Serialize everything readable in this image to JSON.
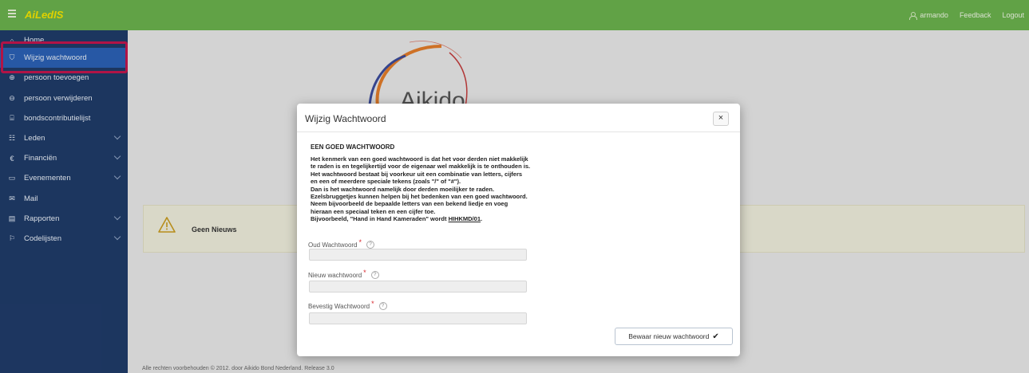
{
  "app": {
    "brand": "AiLedIS"
  },
  "topbar": {
    "username": "armando",
    "feedback": "Feedback",
    "logout": "Logout"
  },
  "sidebar": {
    "items": [
      {
        "label": "Home",
        "icon": "home-icon",
        "glyph": "⌂",
        "dropdown": false,
        "active": false
      },
      {
        "label": "Wijzig wachtwoord",
        "icon": "shield-icon",
        "glyph": "⛉",
        "dropdown": false,
        "active": true
      },
      {
        "label": "persoon toevoegen",
        "icon": "add-circle-icon",
        "glyph": "⊕",
        "dropdown": false,
        "active": false
      },
      {
        "label": "persoon verwijderen",
        "icon": "remove-circle-icon",
        "glyph": "⊖",
        "dropdown": false,
        "active": false
      },
      {
        "label": "bondscontributielijst",
        "icon": "bank-icon",
        "glyph": "⌸",
        "dropdown": false,
        "active": false
      },
      {
        "label": "Leden",
        "icon": "users-icon",
        "glyph": "☷",
        "dropdown": true,
        "active": false
      },
      {
        "label": "Financiën",
        "icon": "euro-icon",
        "glyph": "€",
        "dropdown": true,
        "active": false
      },
      {
        "label": "Evenementen",
        "icon": "folder-icon",
        "glyph": "▭",
        "dropdown": true,
        "active": false
      },
      {
        "label": "Mail",
        "icon": "mail-icon",
        "glyph": "✉",
        "dropdown": false,
        "active": false
      },
      {
        "label": "Rapporten",
        "icon": "report-icon",
        "glyph": "▤",
        "dropdown": true,
        "active": false
      },
      {
        "label": "Codelijsten",
        "icon": "flag-icon",
        "glyph": "⚐",
        "dropdown": true,
        "active": false
      }
    ]
  },
  "main": {
    "logo_text": "Aikido",
    "news": "Geen Nieuws",
    "footer": "Alle rechten voorbehouden © 2012. door Aikido Bond Nederland. Release 3.0"
  },
  "modal": {
    "title": "Wijzig Wachtwoord",
    "close": "×",
    "heading": "EEN GOED WACHTWOORD",
    "lines": [
      "Het kenmerk van een goed wachtwoord is dat het voor derden niet makkelijk",
      "te raden is en tegelijkertijd voor de eigenaar wel makkelijk is te onthouden is.",
      "Het wachtwoord bestaat bij voorkeur uit een combinatie van letters, cijfers",
      "en een of meerdere speciale tekens (zoals \"/\" of \"#\").",
      "Dan is het wachtwoord namelijk door derden moeilijker te raden.",
      "Ezelsbruggetjes kunnen helpen bij het bedenken van een goed wachtwoord.",
      "Neem bijvoorbeeld de bepaalde letters van een bekend liedje en voeg",
      "hieraan een speciaal teken en een cijfer toe."
    ],
    "example_prefix": "Bijvoorbeeld, \"Hand in Hand Kameraden\" wordt ",
    "example_value": "HIHKMD/01",
    "example_suffix": ".",
    "fields": [
      {
        "label": "Oud Wachtwoord",
        "required": "*",
        "help": "?",
        "value": ""
      },
      {
        "label": "Nieuw wachtwoord",
        "required": "*",
        "help": "?",
        "value": ""
      },
      {
        "label": "Bevestig Wachtwoord",
        "required": "*",
        "help": "?",
        "value": ""
      }
    ],
    "save_label": "Bewaar nieuw wachtwoord",
    "save_icon": "✔"
  },
  "colors": {
    "topbar": "#6ab04c",
    "sidebar": "#1f3b68",
    "active_item": "#2b60b3",
    "brand": "#f2e300",
    "highlight": "#c0164c",
    "news_bg": "#ecebd9"
  }
}
